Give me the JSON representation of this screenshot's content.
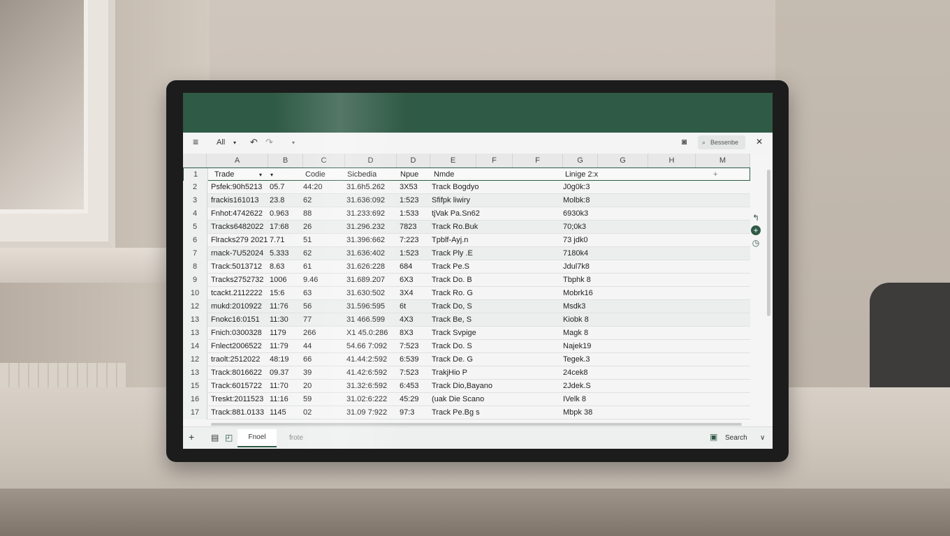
{
  "toolbar": {
    "menu_icon": "≡",
    "filter_label": "All",
    "filter_caret": "▾",
    "undo_icon": "↶",
    "redo_icon": "↷",
    "more_caret": "▾",
    "camera_icon": "◙",
    "search_icon": "⌕",
    "search_placeholder": "Bessenbe",
    "close_icon": "✕"
  },
  "columns": [
    "A",
    "B",
    "C",
    "D",
    "D",
    "E",
    "F",
    "F",
    "G",
    "G",
    "H",
    "M"
  ],
  "header_row": {
    "num": "1",
    "cells": [
      "Trade",
      "▾",
      "▾",
      "Codie",
      "Sicbedia",
      "Npue",
      "Nmde",
      "Linige 2:x",
      "+"
    ]
  },
  "rows": [
    {
      "num": "2",
      "cells": [
        "Psfek:90h5213",
        "05.7",
        "44:20",
        "31.6h5.262",
        "3X53",
        "Track Bogdyo",
        "J0g0k:3"
      ]
    },
    {
      "num": "3",
      "cells": [
        "frackis161013",
        "23.8",
        "62",
        "31.636:092",
        "1:523",
        "Sfifpk liwiry",
        "Molbk:8"
      ]
    },
    {
      "num": "4",
      "cells": [
        "Fnhot:4742622",
        "0.963",
        "88",
        "31.233:692",
        "1:533",
        "tjVak Pa.Sn62",
        "6930k3"
      ]
    },
    {
      "num": "5",
      "cells": [
        "Tracks6482022",
        "17:68",
        "26",
        "31.296.232",
        "7823",
        "Track Ro.Buk",
        "70;0k3"
      ]
    },
    {
      "num": "6",
      "cells": [
        "Flracks279 2021",
        "7.71",
        "51",
        "31.396:662",
        "7:223",
        "Tpblf-Ayj.n",
        "73 jdk0"
      ]
    },
    {
      "num": "7",
      "cells": [
        "rnack-7U52024",
        "5.333",
        "62",
        "31.636:402",
        "1:523",
        "Track Ply .E",
        "7180k4"
      ]
    },
    {
      "num": "8",
      "cells": [
        "Track:5013712",
        "8.63",
        "61",
        "31.626:228",
        "684",
        "Track Pe.S",
        "Jdul7k8"
      ]
    },
    {
      "num": "9",
      "cells": [
        "Tracks2752732",
        "1006",
        "9.46",
        "31.689.207",
        "6X3",
        "Track Do. B",
        "Tbphk 8"
      ]
    },
    {
      "num": "10",
      "cells": [
        "tcackt.2112222",
        "15:6",
        "63",
        "31.630:502",
        "3X4",
        "Track Ro. G",
        "Mobrk16"
      ]
    },
    {
      "num": "12",
      "cells": [
        "mukd:2010922",
        "11:76",
        "56",
        "31.596:595",
        "6t",
        "Track Do, S",
        "Msdk3"
      ]
    },
    {
      "num": "13",
      "cells": [
        "Fnokc16:0151",
        "11:30",
        "77",
        "31 466.599",
        "4X3",
        "Track Be, S",
        "Kiobk 8"
      ]
    },
    {
      "num": "13",
      "cells": [
        "Fnich:0300328",
        "1179",
        "266",
        "X1 45.0:286",
        "8X3",
        "Track Svpige",
        "Magk 8"
      ]
    },
    {
      "num": "14",
      "cells": [
        "Fnlect2006522",
        "11:79",
        "44",
        "54.66 7:092",
        "7:523",
        "Track Do. S",
        "Najek19"
      ]
    },
    {
      "num": "12",
      "cells": [
        "traolt:2512022",
        "48:19",
        "66",
        "41.44:2:592",
        "6:539",
        "Track De. G",
        "Tegek.3"
      ]
    },
    {
      "num": "13",
      "cells": [
        "Track:8016622",
        "09.37",
        "39",
        "41.42:6:592",
        "7:523",
        "TrakjHio P",
        "24cek8"
      ]
    },
    {
      "num": "15",
      "cells": [
        "Track:6015722",
        "11:70",
        "20",
        "31.32:6:592",
        "6:453",
        "Track Dio,Bayano",
        "2Jdek.S"
      ]
    },
    {
      "num": "16",
      "cells": [
        "Treskt:2011523",
        "11:16",
        "59",
        "31.02:6:222",
        "45:29",
        "(uak Die Scano",
        "IVelk 8"
      ]
    },
    {
      "num": "17",
      "cells": [
        "Track:881.0133",
        "1145",
        "02",
        "31.09 7:922",
        "97:3",
        "Track Pe.Bg s",
        "Mbpk 38"
      ]
    }
  ],
  "side_icons": [
    "↰",
    "+",
    "◷"
  ],
  "statusbar": {
    "add_icon": "+",
    "sheets_icon": "▤",
    "format_icon": "◰",
    "sheet_tab": "Fnoel",
    "sheet_tab2": "frote",
    "status_icon": "▣",
    "search_label": "Search",
    "collapse_icon": "∨"
  }
}
